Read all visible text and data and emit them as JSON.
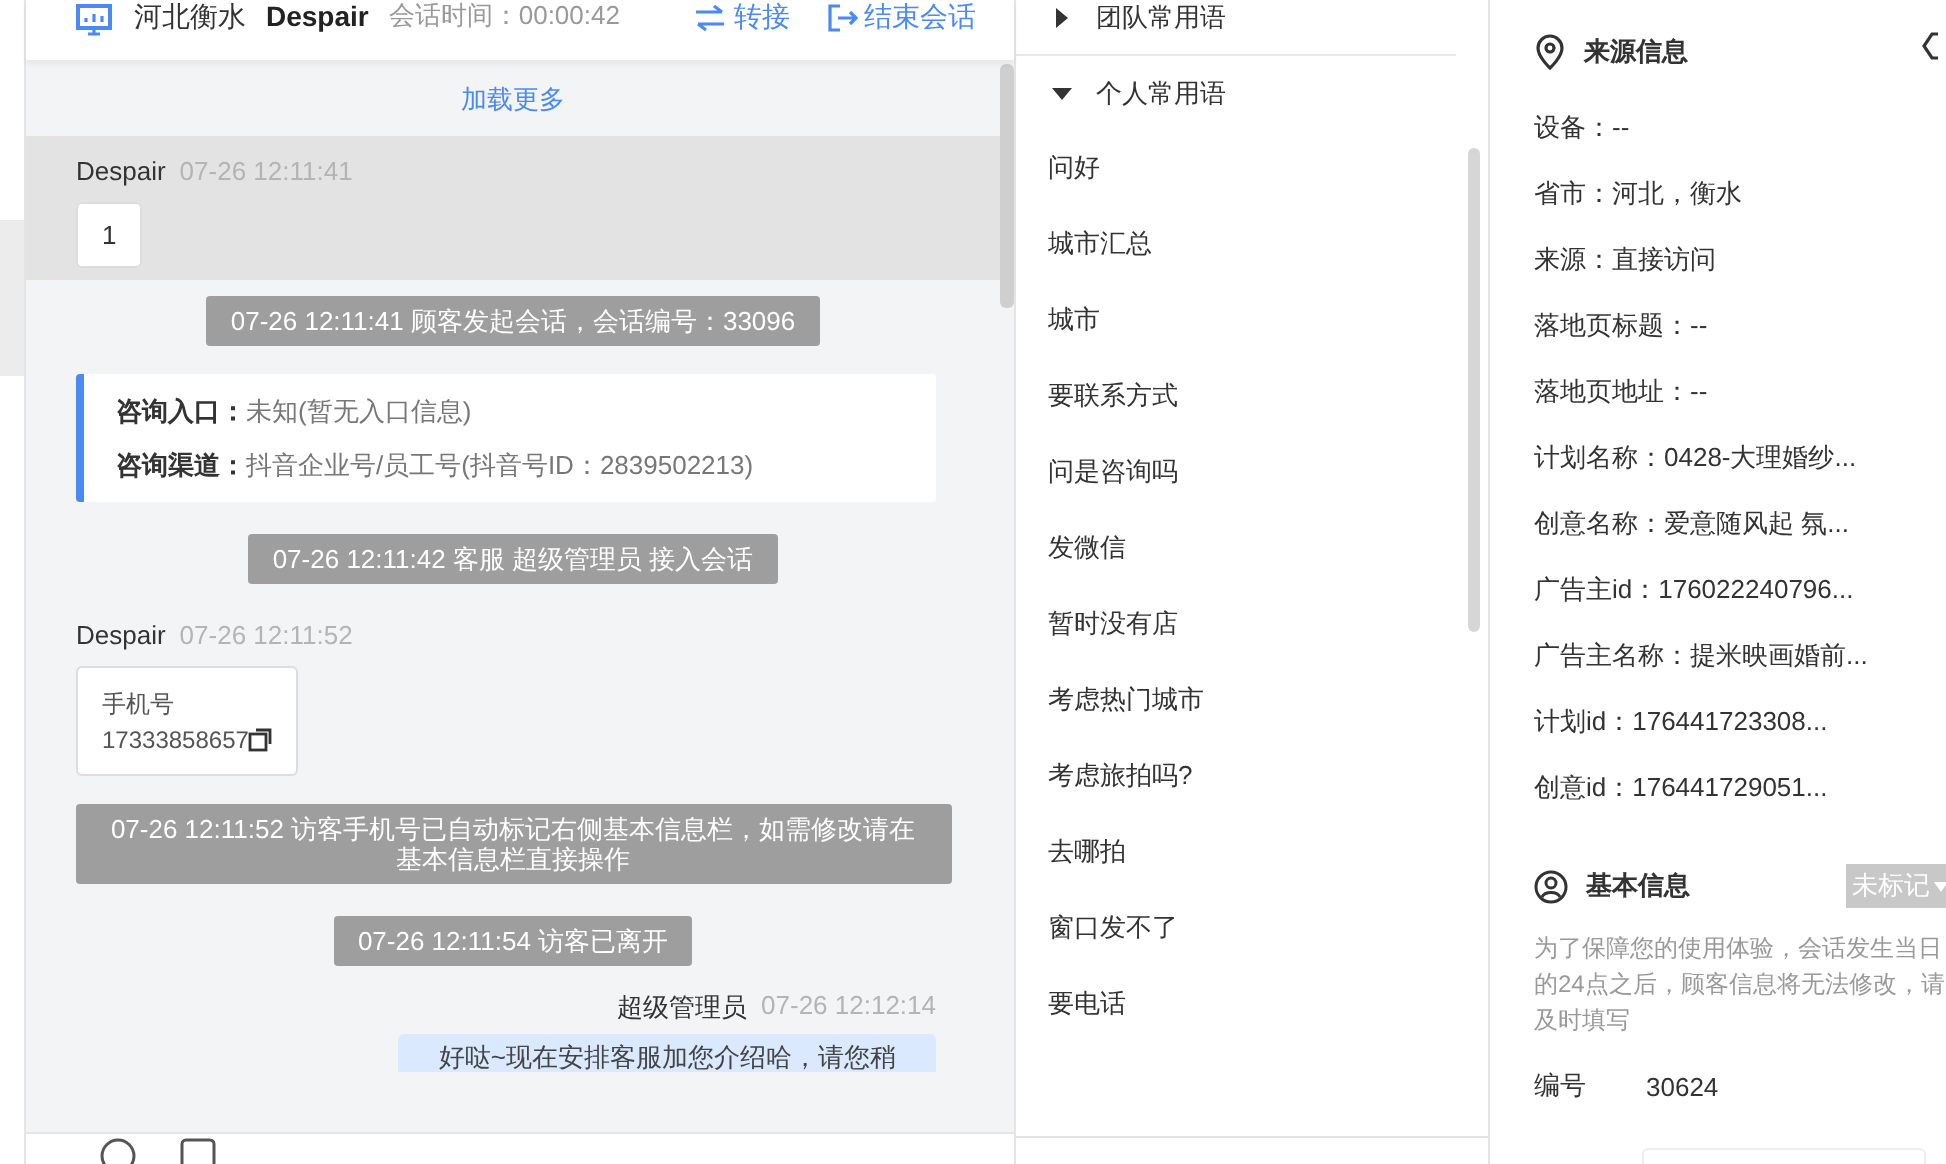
{
  "header": {
    "location": "河北衡水",
    "visitor": "Despair",
    "duration": "会话时间：00:00:42",
    "actions": [
      {
        "kind": "transfer",
        "label": "转接"
      },
      {
        "kind": "end",
        "label": "结束会话"
      }
    ]
  },
  "chat": {
    "load_more": "加载更多",
    "messages": [
      {
        "kind": "customer",
        "sender": "Despair",
        "time": "07-26 12:11:41",
        "text": "1",
        "highlighted": true
      },
      {
        "kind": "system",
        "text": "07-26 12:11:41 顾客发起会话，会话编号：33096"
      },
      {
        "kind": "entry_info",
        "rows": [
          {
            "label": "咨询入口：",
            "value": "未知(暂无入口信息)"
          },
          {
            "label": "咨询渠道：",
            "value": "抖音企业号/员工号(抖音号ID：2839502213)"
          }
        ]
      },
      {
        "kind": "system",
        "text": "07-26 12:11:42 客服 超级管理员 接入会话"
      },
      {
        "kind": "phone_card",
        "sender": "Despair",
        "time": "07-26 12:11:52",
        "label": "手机号",
        "number": "17333858657"
      },
      {
        "kind": "system",
        "text": "07-26 12:11:52 访客手机号已自动标记右侧基本信息栏，如需修改请在基本信息栏直接操作"
      },
      {
        "kind": "system",
        "text": "07-26 12:11:54 访客已离开"
      },
      {
        "kind": "agent",
        "sender": "超级管理员",
        "time": "07-26 12:12:14",
        "text": "好哒~现在安排客服加您介绍哈，请您稍"
      }
    ]
  },
  "phrases": {
    "groups": [
      {
        "title": "团队常用语",
        "expanded": false
      },
      {
        "title": "个人常用语",
        "expanded": true,
        "items": [
          "问好",
          "城市汇总",
          "城市",
          "要联系方式",
          "问是咨询吗",
          "发微信",
          "暂时没有店",
          "考虑热门城市",
          "考虑旅拍吗?",
          "去哪拍",
          "窗口发不了",
          "要电话"
        ]
      }
    ]
  },
  "info": {
    "source": {
      "title": "来源信息",
      "rows": [
        "设备：--",
        "省市：河北，衡水",
        "来源：直接访问",
        "落地页标题：--",
        "落地页地址：--",
        "计划名称：0428-大理婚纱...",
        "创意名称：爱意随风起 氛...",
        "广告主id：176022240796...",
        "广告主名称：提米映画婚前...",
        "计划id：176441723308...",
        "创意id：176441729051..."
      ]
    },
    "basic": {
      "title": "基本信息",
      "tag": "未标记",
      "notice": "为了保障您的使用体验，会话发生当日的24点之后，顾客信息将无法修改，请及时填写",
      "fields": [
        {
          "label": "编号",
          "value": "30624"
        }
      ]
    }
  }
}
